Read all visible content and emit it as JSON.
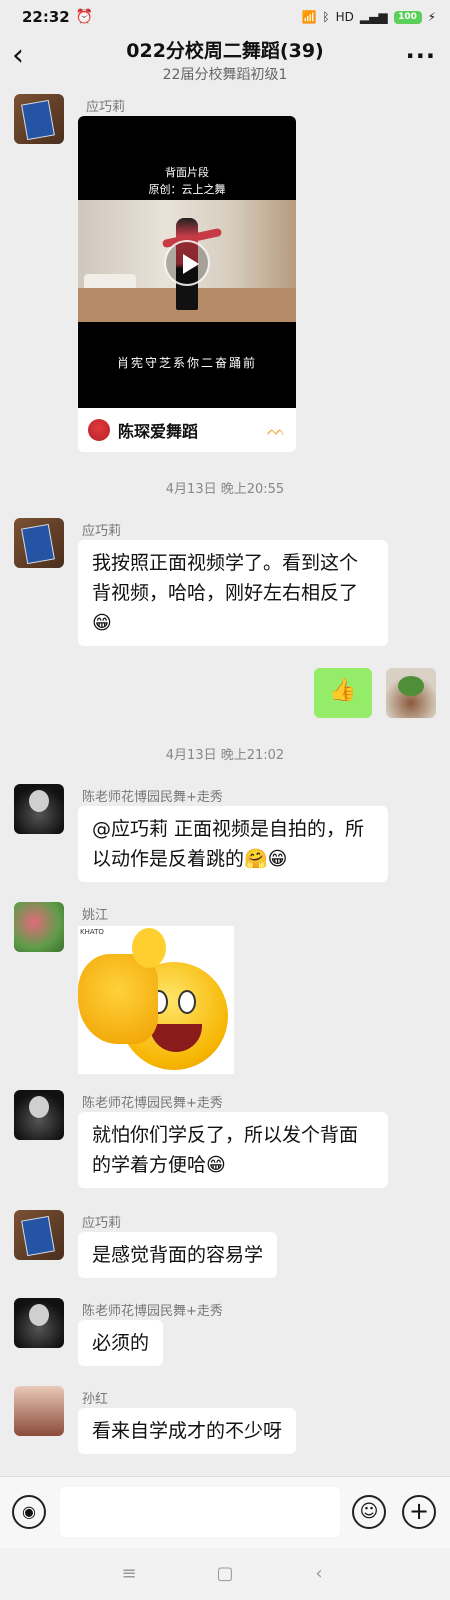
{
  "status_bar": {
    "time": "22:32",
    "alarm_icon": "alarm-icon",
    "network": "HD",
    "battery": "100"
  },
  "header": {
    "title": "022分校周二舞蹈(39)",
    "subtitle": "22届分校舞蹈初级1"
  },
  "messages": [
    {
      "sender": "应巧莉",
      "type": "video",
      "video": {
        "caption_top": "背面片段",
        "caption_sub": "原创：云上之舞",
        "caption_bottom": "肖宪守芝系你二奋踊前",
        "channel": "陈琛爱舞蹈"
      }
    },
    {
      "timestamp": "4月13日 晚上20:55"
    },
    {
      "sender": "应巧莉",
      "text": "我按照正面视频学了。看到这个背视频，哈哈，刚好左右相反了",
      "emoji": "😁"
    },
    {
      "sender": "me",
      "text": "👍"
    },
    {
      "timestamp": "4月13日 晚上21:02"
    },
    {
      "sender": "陈老师花博园民舞+走秀",
      "text": "@应巧莉  正面视频是自拍的，所以动作是反着跳的",
      "emoji": "🤗😁"
    },
    {
      "sender": "姚江",
      "type": "sticker",
      "sticker_label": "KHATO"
    },
    {
      "sender": "陈老师花博园民舞+走秀",
      "text": "就怕你们学反了，所以发个背面的学着方便哈",
      "emoji": "😁"
    },
    {
      "sender": "应巧莉",
      "text": "是感觉背面的容易学"
    },
    {
      "sender": "陈老师花博园民舞+走秀",
      "text": "必须的"
    },
    {
      "sender": "孙红",
      "text": "看来自学成才的不少呀"
    }
  ],
  "nav": {
    "menu": "≡",
    "home": "▢",
    "back": "‹"
  }
}
